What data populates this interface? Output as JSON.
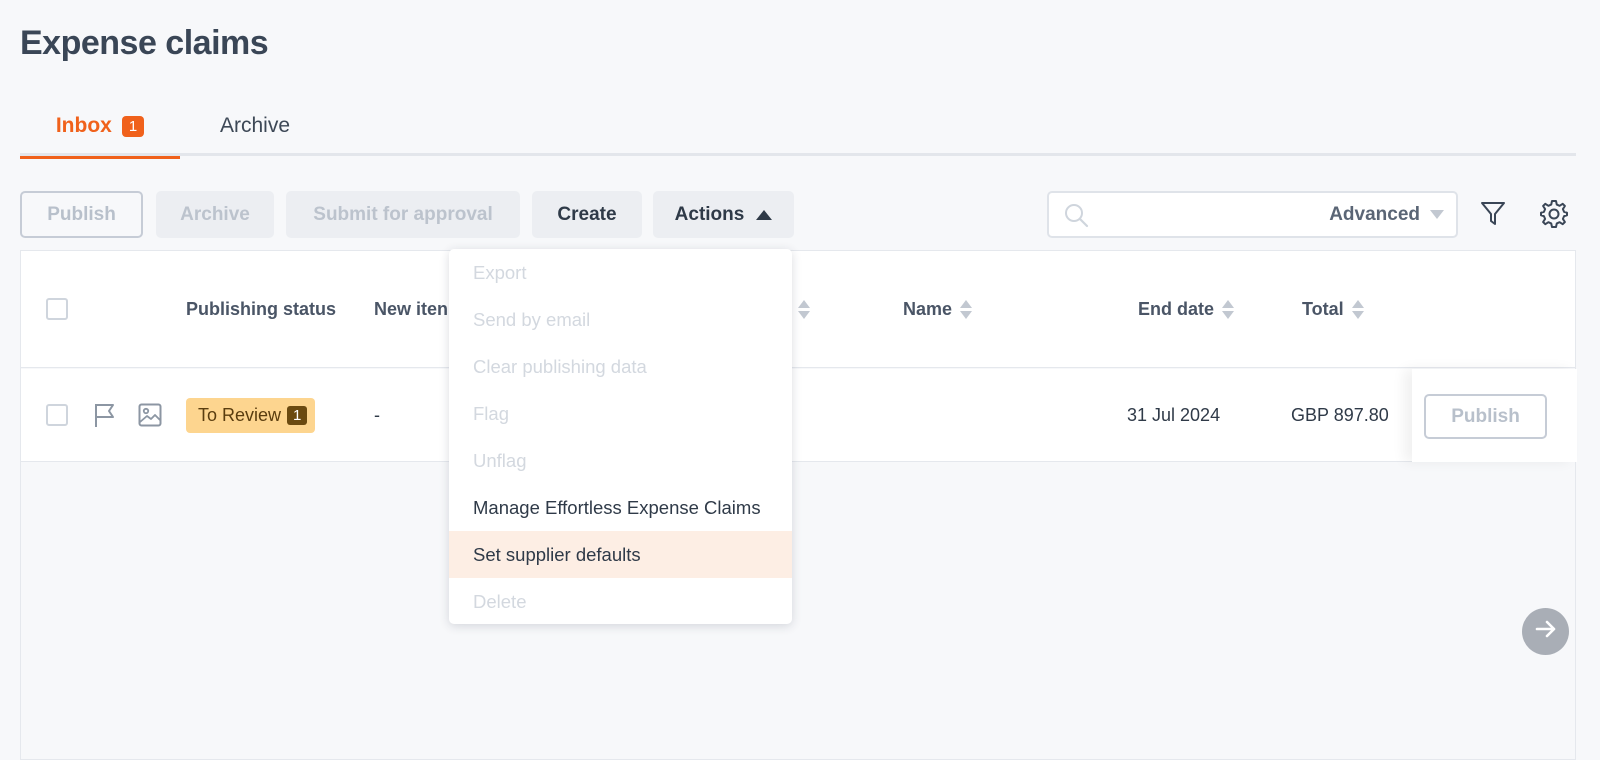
{
  "page": {
    "title": "Expense claims"
  },
  "tabs": [
    {
      "label": "Inbox",
      "badge": "1",
      "active": true
    },
    {
      "label": "Archive",
      "active": false
    }
  ],
  "toolbar": {
    "publish": "Publish",
    "archive": "Archive",
    "submit": "Submit for approval",
    "create": "Create",
    "actions": "Actions",
    "search_value": "",
    "advanced": "Advanced"
  },
  "table": {
    "columns": {
      "publishing_status": "Publishing status",
      "new_items": "New iten",
      "name": "Name",
      "end_date": "End date",
      "total": "Total"
    },
    "rows": [
      {
        "status": "To Review",
        "status_count": "1",
        "new_items": "-",
        "end_date": "31 Jul 2024",
        "total": "GBP 897.80",
        "publish": "Publish"
      }
    ]
  },
  "actions_menu": [
    {
      "label": "Export",
      "enabled": false
    },
    {
      "label": "Send by email",
      "enabled": false
    },
    {
      "label": "Clear publishing data",
      "enabled": false
    },
    {
      "label": "Flag",
      "enabled": false
    },
    {
      "label": "Unflag",
      "enabled": false
    },
    {
      "label": "Manage Effortless Expense Claims",
      "enabled": true
    },
    {
      "label": "Set supplier defaults",
      "enabled": true,
      "highlighted": true
    },
    {
      "label": "Delete",
      "enabled": false
    }
  ],
  "colors": {
    "accent": "#f0611b",
    "status_badge": "#fdd58f",
    "menu_highlight": "#fdeee4"
  },
  "icons": [
    "search-icon",
    "filter-icon",
    "gear-icon",
    "flag-icon",
    "image-icon",
    "arrow-right-icon",
    "caret-up-icon",
    "caret-down-icon",
    "sort-icon"
  ]
}
